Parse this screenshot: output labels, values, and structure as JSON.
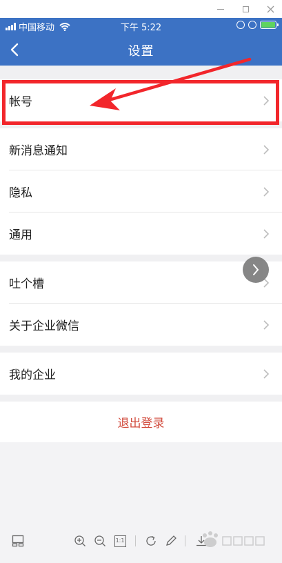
{
  "status_bar": {
    "carrier": "中国移动",
    "time": "下午 5:22"
  },
  "nav": {
    "title": "设置"
  },
  "groups": [
    {
      "items": [
        {
          "label": "帐号"
        }
      ]
    },
    {
      "items": [
        {
          "label": "新消息通知"
        },
        {
          "label": "隐私"
        },
        {
          "label": "通用"
        }
      ]
    },
    {
      "items": [
        {
          "label": "吐个槽"
        },
        {
          "label": "关于企业微信"
        }
      ]
    },
    {
      "items": [
        {
          "label": "我的企业"
        }
      ]
    }
  ],
  "logout": {
    "label": "退出登录"
  },
  "toolbar": {
    "actual_size_label": "1:1"
  },
  "colors": {
    "header": "#3c72c4",
    "logout_text": "#d24b3d",
    "annotation": "#f2262b",
    "battery": "#5fd35f"
  }
}
